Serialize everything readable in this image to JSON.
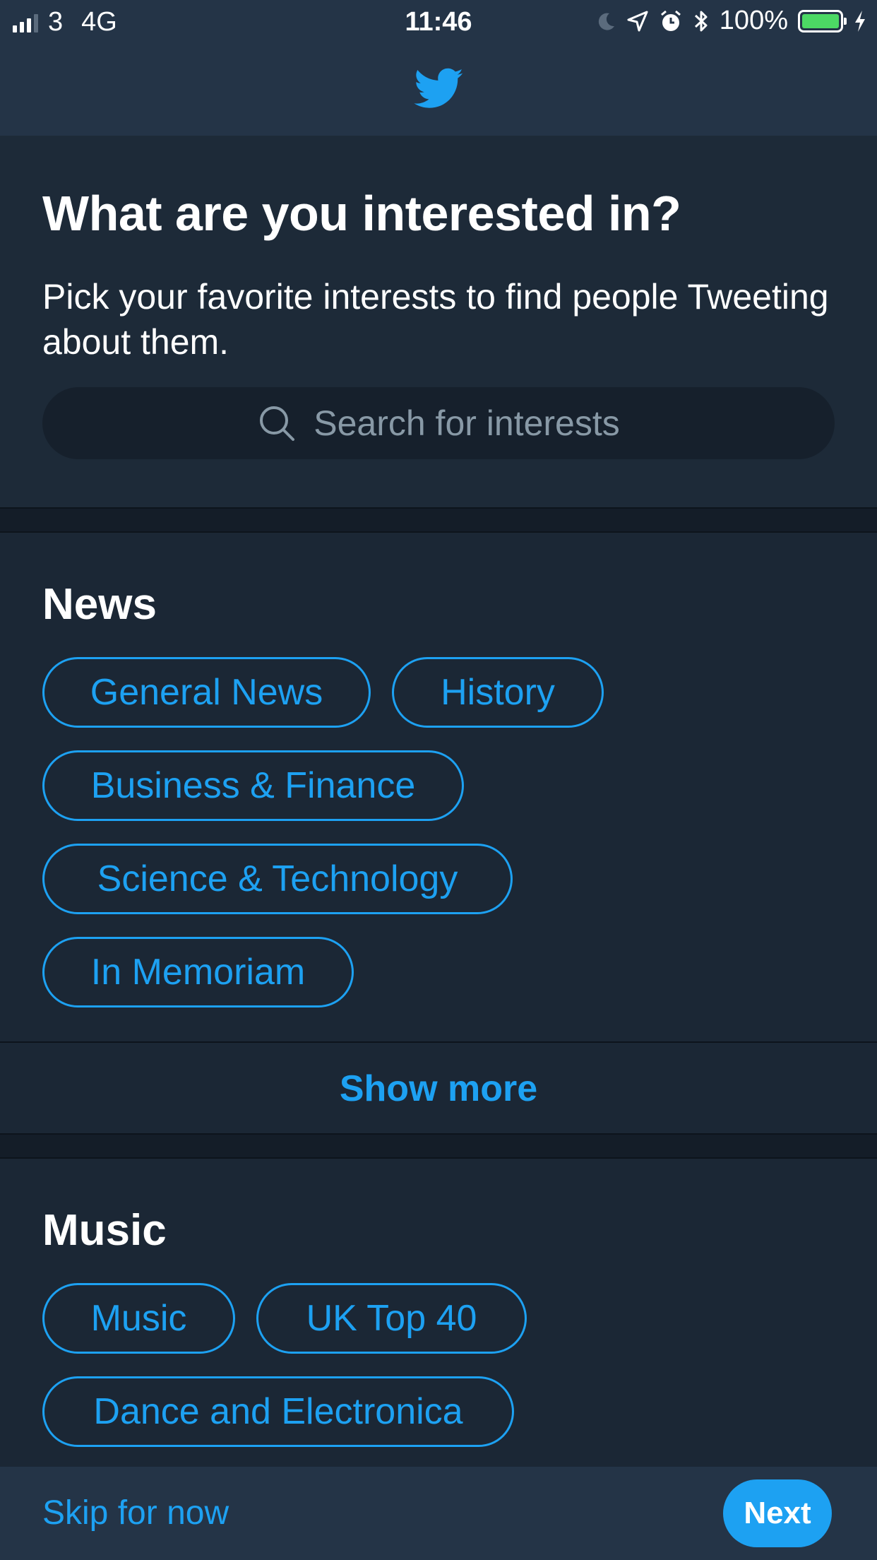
{
  "status_bar": {
    "carrier": "3",
    "network": "4G",
    "time": "11:46",
    "battery": "100%",
    "icons": [
      "moon-icon",
      "location-icon",
      "alarm-icon",
      "bluetooth-icon",
      "battery-icon",
      "charging-icon"
    ]
  },
  "header": {
    "logo": "twitter-bird-icon",
    "accent_color": "#1da1f2"
  },
  "intro": {
    "title": "What are you interested in?",
    "subtitle": "Pick your favorite interests to find people Tweeting about them.",
    "search_placeholder": "Search for interests"
  },
  "sections": [
    {
      "title": "News",
      "interests": [
        "General News",
        "History",
        "Business & Finance",
        "Science & Technology",
        "In Memoriam"
      ],
      "show_more_label": "Show more"
    },
    {
      "title": "Music",
      "interests": [
        "Music",
        "UK Top 40",
        "Dance and Electronica"
      ]
    }
  ],
  "footer": {
    "skip_label": "Skip for now",
    "next_label": "Next"
  }
}
